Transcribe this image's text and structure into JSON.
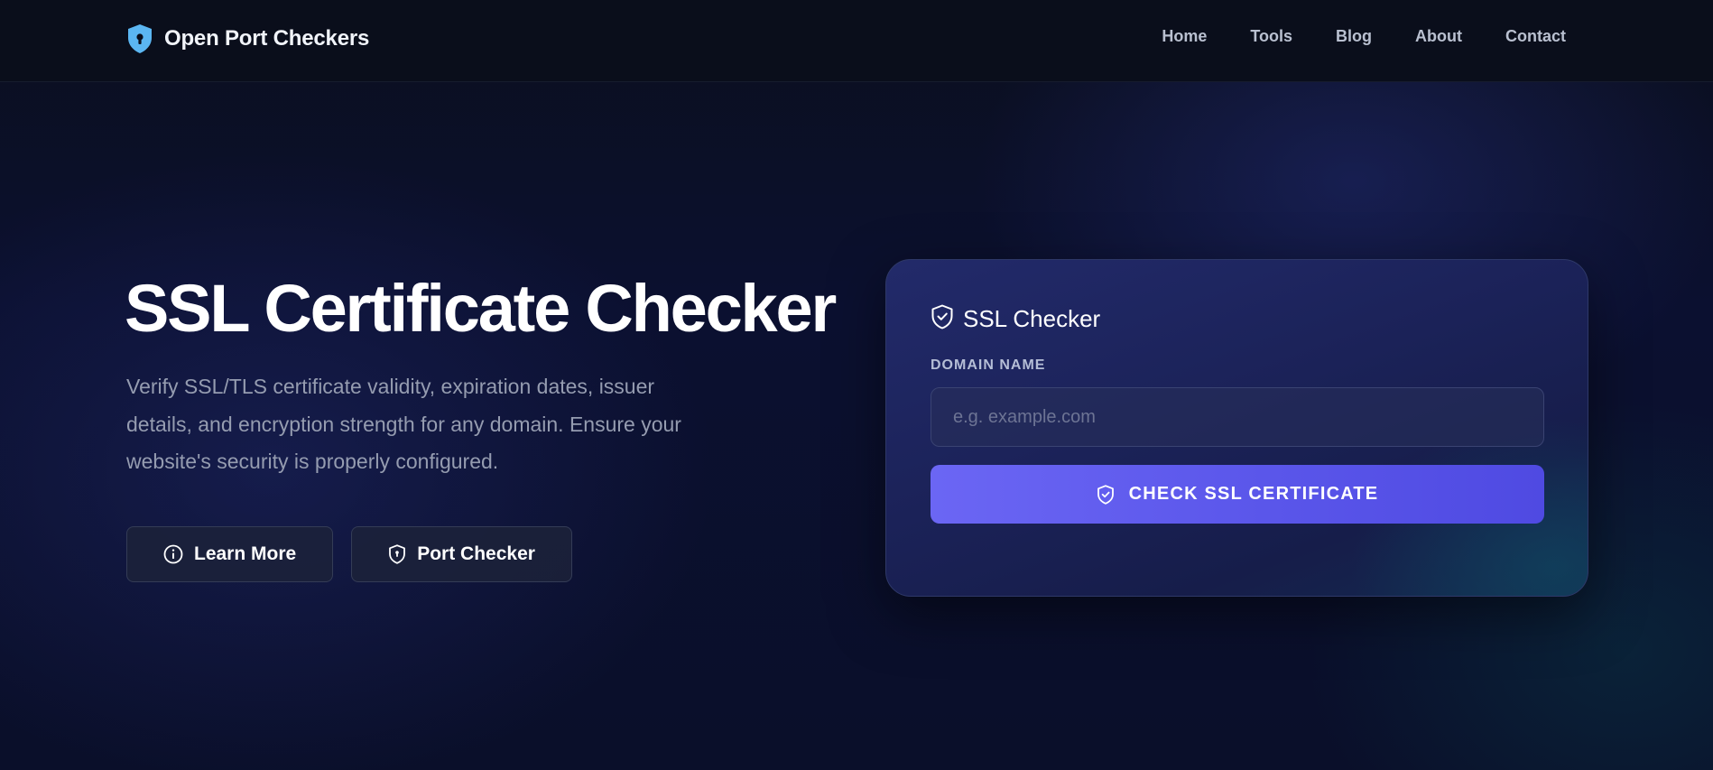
{
  "header": {
    "brand_name": "Open Port Checkers",
    "brand_icon": "shield-lock-icon",
    "nav": [
      {
        "label": "Home"
      },
      {
        "label": "Tools"
      },
      {
        "label": "Blog"
      },
      {
        "label": "About"
      },
      {
        "label": "Contact"
      }
    ]
  },
  "hero": {
    "title": "SSL Certificate Checker",
    "description": "Verify SSL/TLS certificate validity, expiration dates, issuer details, and encryption strength for any domain. Ensure your website's security is properly configured.",
    "buttons": [
      {
        "label": "Learn More",
        "icon": "info-icon"
      },
      {
        "label": "Port Checker",
        "icon": "shield-icon"
      }
    ]
  },
  "checker_card": {
    "title": "SSL Checker",
    "title_icon": "shield-check-icon",
    "field_label": "DOMAIN NAME",
    "input_value": "",
    "input_placeholder": "e.g. example.com",
    "submit_label": "CHECK SSL CERTIFICATE",
    "submit_icon": "shield-check-icon"
  },
  "colors": {
    "accent": "#5b57eb",
    "brand_icon": "#5bb6f2",
    "background": "#0a0f1f"
  }
}
